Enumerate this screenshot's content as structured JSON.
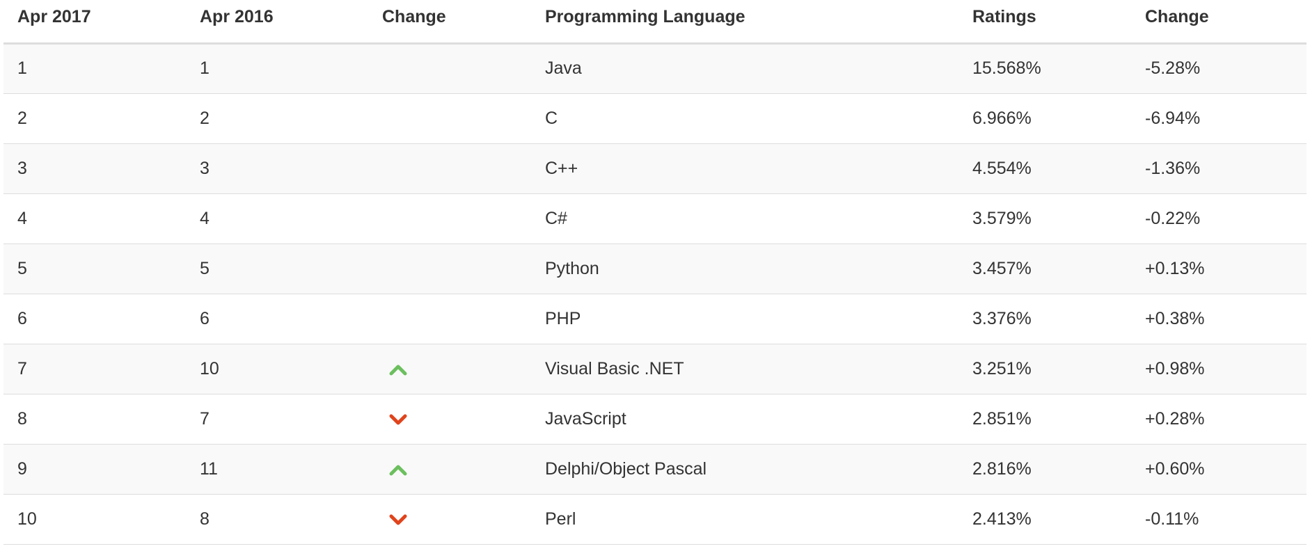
{
  "table": {
    "headers": [
      "Apr 2017",
      "Apr 2016",
      "Change",
      "Programming Language",
      "Ratings",
      "Change"
    ],
    "rows": [
      {
        "rank_2017": "1",
        "rank_2016": "1",
        "trend": "none",
        "language": "Java",
        "ratings": "15.568%",
        "change": "-5.28%"
      },
      {
        "rank_2017": "2",
        "rank_2016": "2",
        "trend": "none",
        "language": "C",
        "ratings": "6.966%",
        "change": "-6.94%"
      },
      {
        "rank_2017": "3",
        "rank_2016": "3",
        "trend": "none",
        "language": "C++",
        "ratings": "4.554%",
        "change": "-1.36%"
      },
      {
        "rank_2017": "4",
        "rank_2016": "4",
        "trend": "none",
        "language": "C#",
        "ratings": "3.579%",
        "change": "-0.22%"
      },
      {
        "rank_2017": "5",
        "rank_2016": "5",
        "trend": "none",
        "language": "Python",
        "ratings": "3.457%",
        "change": "+0.13%"
      },
      {
        "rank_2017": "6",
        "rank_2016": "6",
        "trend": "none",
        "language": "PHP",
        "ratings": "3.376%",
        "change": "+0.38%"
      },
      {
        "rank_2017": "7",
        "rank_2016": "10",
        "trend": "up",
        "language": "Visual Basic .NET",
        "ratings": "3.251%",
        "change": "+0.98%"
      },
      {
        "rank_2017": "8",
        "rank_2016": "7",
        "trend": "down",
        "language": "JavaScript",
        "ratings": "2.851%",
        "change": "+0.28%"
      },
      {
        "rank_2017": "9",
        "rank_2016": "11",
        "trend": "up",
        "language": "Delphi/Object Pascal",
        "ratings": "2.816%",
        "change": "+0.60%"
      },
      {
        "rank_2017": "10",
        "rank_2016": "8",
        "trend": "down",
        "language": "Perl",
        "ratings": "2.413%",
        "change": "-0.11%"
      }
    ]
  },
  "icons": {
    "up": "chevron-up-icon",
    "down": "chevron-down-icon"
  },
  "colors": {
    "up_arrow": "#6cbf5e",
    "down_arrow": "#e0441c",
    "text": "#333333",
    "stripe": "#f9f9f9",
    "border": "#dddddd"
  }
}
